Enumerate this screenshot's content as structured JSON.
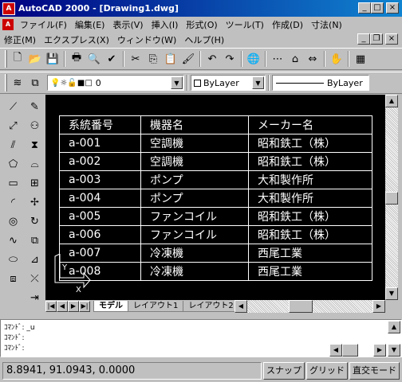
{
  "window": {
    "title": "AutoCAD 2000 - [Drawing1.dwg]",
    "minimize": "_",
    "maximize": "□",
    "close": "×",
    "doc_minimize": "_",
    "doc_restore": "❐",
    "doc_close": "×"
  },
  "menu": {
    "row1": [
      "ファイル(F)",
      "編集(E)",
      "表示(V)",
      "挿入(I)",
      "形式(O)",
      "ツール(T)",
      "作成(D)",
      "寸法(N)"
    ],
    "row2": [
      "修正(M)",
      "エクスプレス(X)",
      "ウィンドウ(W)",
      "ヘルプ(H)"
    ]
  },
  "properties_toolbar": {
    "layer_value": "0",
    "color_value": "ByLayer",
    "linetype_value": "ByLayer"
  },
  "table": {
    "headers": [
      "系統番号",
      "機器名",
      "メーカー名"
    ],
    "rows": [
      [
        "a-001",
        "空調機",
        "昭和鉄工（株）"
      ],
      [
        "a-002",
        "空調機",
        "昭和鉄工（株）"
      ],
      [
        "a-003",
        "ポンプ",
        "大和製作所"
      ],
      [
        "a-004",
        "ポンプ",
        "大和製作所"
      ],
      [
        "a-005",
        "ファンコイル",
        "昭和鉄工（株）"
      ],
      [
        "a-006",
        "ファンコイル",
        "昭和鉄工（株）"
      ],
      [
        "a-007",
        "冷凍機",
        "西尾工業"
      ],
      [
        "a-008",
        "冷凍機",
        "西尾工業"
      ]
    ]
  },
  "tabs": {
    "model": "モデル",
    "layout1": "レイアウト1",
    "layout2": "レイアウト2"
  },
  "command": {
    "lines": [
      "ｺﾏﾝﾄﾞ: _u",
      "ｺﾏﾝﾄﾞ:",
      "ｺﾏﾝﾄﾞ:"
    ]
  },
  "status": {
    "coords": "8.8941, 91.0943, 0.0000",
    "snap": "スナップ",
    "grid": "グリッド",
    "ortho": "直交モード"
  },
  "icons": {
    "standard": [
      "new-icon",
      "open-icon",
      "save-icon",
      "print-icon",
      "print-preview-icon",
      "spell-check-icon",
      "cut-icon",
      "copy-icon",
      "paste-icon",
      "match-properties-icon",
      "undo-icon",
      "redo-icon",
      "hyperlink-icon",
      "tracking-icon",
      "snap-from-icon",
      "distance-icon"
    ],
    "colors": {
      "titlebar_start": "#000080",
      "titlebar_end": "#1084d0",
      "drawing_bg": "#000000",
      "table_line": "#ffffff"
    }
  }
}
